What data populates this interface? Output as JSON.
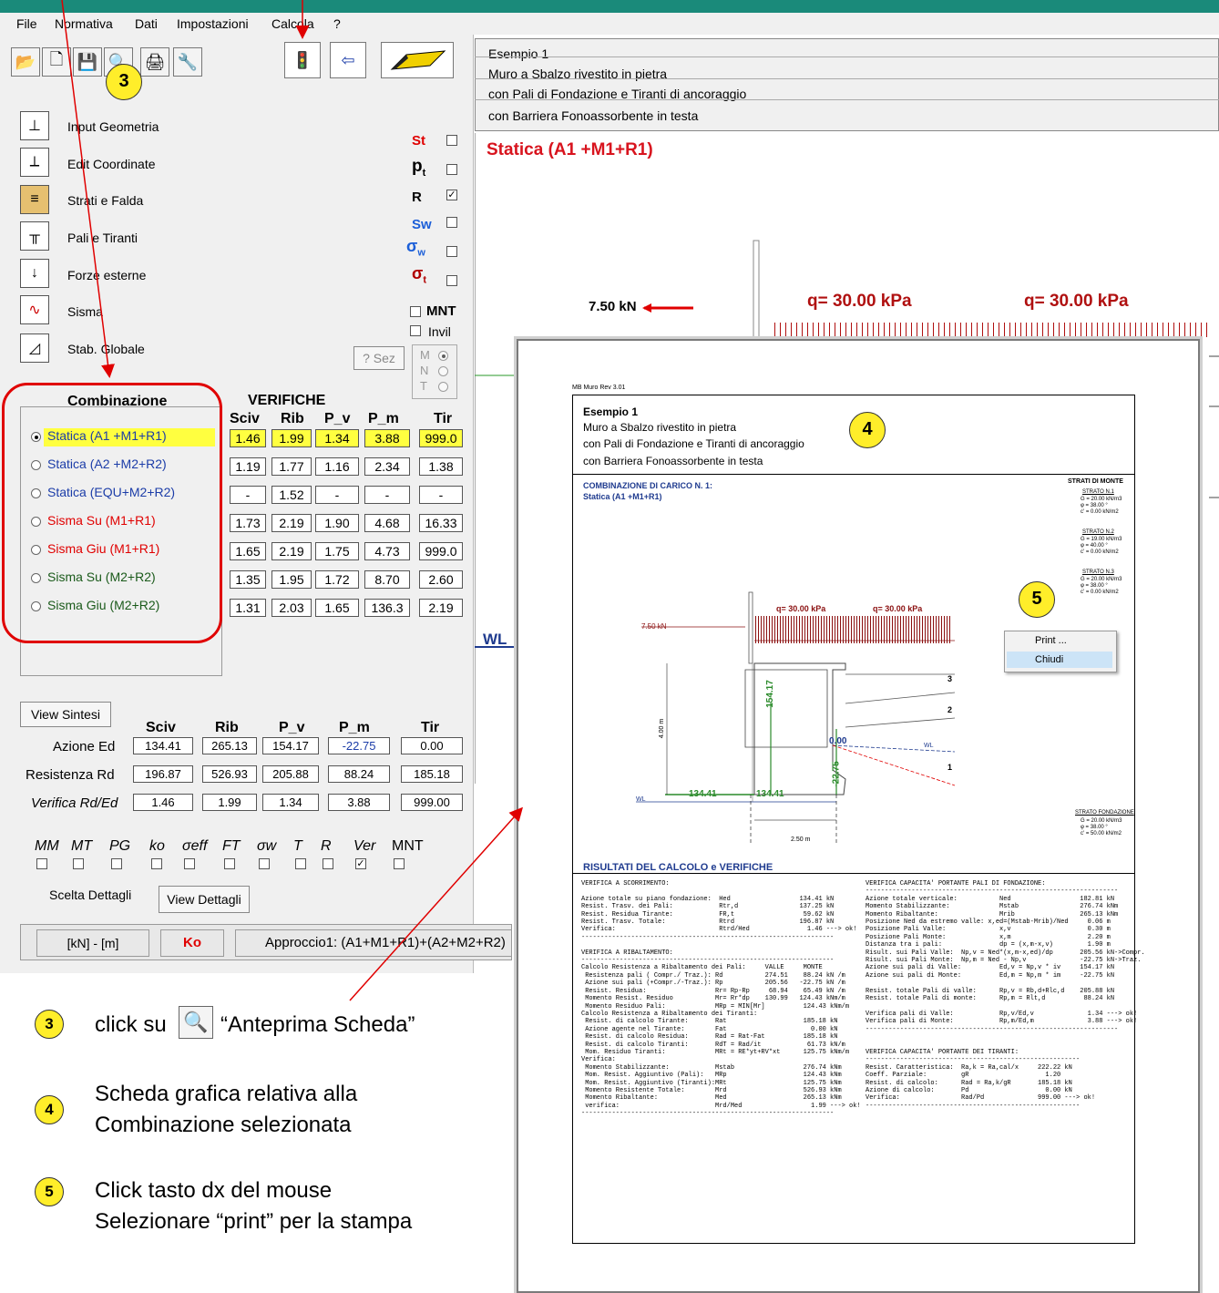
{
  "menu": [
    "File",
    "Normativa",
    "Dati",
    "Impostazioni",
    "Calcola",
    "?"
  ],
  "commands": [
    "Input Geometria",
    "Edit Coordinate",
    "Strati e Falda",
    "Pali e Tiranti",
    "Forze esterne",
    "Sisma",
    "Stab. Globale"
  ],
  "flags": {
    "st": "St",
    "pt": "p",
    "pt_sub": "t",
    "r": "R",
    "sw": "Sw",
    "sigw": "σ",
    "sigw_sub": "w",
    "sigt": "σ",
    "sigt_sub": "t",
    "mnt": "MNT",
    "invil": "Invil"
  },
  "sez_button": "? Sez",
  "mnt_radio": [
    "M",
    "N",
    "T"
  ],
  "combinazione": {
    "title": "Combinazione",
    "items": [
      "Statica  (A1 +M1+R1)",
      "Statica  (A2 +M2+R2)",
      "Statica  (EQU+M2+R2)",
      "Sisma Su  (M1+R1)",
      "Sisma Giu (M1+R1)",
      "Sisma Su  (M2+R2)",
      "Sisma Giu (M2+R2)"
    ]
  },
  "verifiche": {
    "title": "VERIFICHE",
    "headers": [
      "Sciv",
      "Rib",
      "P_v",
      "P_m",
      "Tir"
    ],
    "rows": [
      [
        "1.46",
        "1.99",
        "1.34",
        "3.88",
        "999.0"
      ],
      [
        "1.19",
        "1.77",
        "1.16",
        "2.34",
        "1.38"
      ],
      [
        "-",
        "1.52",
        "-",
        "-",
        "-"
      ],
      [
        "1.73",
        "2.19",
        "1.90",
        "4.68",
        "16.33"
      ],
      [
        "1.65",
        "2.19",
        "1.75",
        "4.73",
        "999.0"
      ],
      [
        "1.35",
        "1.95",
        "1.72",
        "8.70",
        "2.60"
      ],
      [
        "1.31",
        "2.03",
        "1.65",
        "136.3",
        "2.19"
      ]
    ]
  },
  "sintesi": {
    "button": "View Sintesi",
    "headers": [
      "Sciv",
      "Rib",
      "P_v",
      "P_m",
      "Tir"
    ],
    "row_labels": [
      "Azione Ed",
      "Resistenza Rd",
      "Verifica Rd/Ed"
    ],
    "rows": [
      [
        "134.41",
        "265.13",
        "154.17",
        "-22.75",
        "0.00"
      ],
      [
        "196.87",
        "526.93",
        "205.88",
        "88.24",
        "185.18"
      ],
      [
        "1.46",
        "1.99",
        "1.34",
        "3.88",
        "999.00"
      ]
    ]
  },
  "detail_flags": [
    "MM",
    "MT",
    "PG",
    "ko",
    "σeff",
    "FT",
    "σw",
    "T",
    "R",
    "Ver",
    "MNT"
  ],
  "scelta_label": "Scelta Dettagli",
  "view_dettagli": "View Dettagli",
  "status": {
    "units": "[kN] - [m]",
    "result": "Ko",
    "approach": "Approccio1: (A1+M1+R1)+(A2+M2+R2)"
  },
  "description": [
    "Esempio 1",
    "Muro a Sbalzo rivestito in pietra",
    "con Pali di Fondazione e Tiranti di ancoraggio",
    "con Barriera Fonoassorbente in testa"
  ],
  "plot": {
    "title": "Statica  (A1 +M1+R1)",
    "force": "7.50 kN",
    "q1": "q= 30.00 kPa",
    "q2": "q= 30.00 kPa",
    "wl": "WL"
  },
  "sheet": {
    "header": "MB Muro Rev 3.01",
    "desc": [
      "Esempio 1",
      "Muro a Sbalzo rivestito in pietra",
      "con Pali di Fondazione e Tiranti di ancoraggio",
      "con Barriera Fonoassorbente in testa"
    ],
    "comb_title": "COMBINAZIONE DI CARICO N. 1:",
    "comb_name": "Statica  (A1 +M1+R1)",
    "strati_title": "STRATI DI MONTE",
    "strati": [
      {
        "name": "STRATO N.1",
        "g": "G = 20.00 kN/m3",
        "phi": "φ = 38.00 °",
        "c": "c' = 0.00 kN/m2"
      },
      {
        "name": "STRATO N.2",
        "g": "G = 19.00 kN/m3",
        "phi": "φ = 40.00 °",
        "c": "c' = 0.00 kN/m2"
      },
      {
        "name": "STRATO N.3",
        "g": "G = 20.00 kN/m3",
        "phi": "φ = 38.00 °",
        "c": "c' = 0.00 kN/m2"
      }
    ],
    "fondazione": {
      "name": "STRATO FONDAZIONE",
      "g": "G = 20.00 kN/m3",
      "phi": "φ = 38.00 °",
      "c": "c' = 50.00 kN/m2"
    },
    "q1": "q= 30.00 kPa",
    "q2": "q= 30.00 kPa",
    "force": "7.50 kN",
    "dims": {
      "h": "4.00 m",
      "b": "2.50 m"
    },
    "values": {
      "v1": "134.41",
      "v2": "134.41",
      "v3": "154.17",
      "v4": "0.00",
      "v5": "-22.75"
    },
    "wl": "WL",
    "layers": [
      "3",
      "2",
      "1"
    ],
    "results_title": "RISULTATI DEL CALCOLO e VERIFICHE",
    "left_text": "VERIFICA A SCORRIMENTO:\n\nAzione totale su piano fondazione:  Hed                  134.41 kN\nResist. Trasv. dei Pali:            Rtr,d                137.25 kN\nResist. Residua Tirante:            FR,t                  59.62 kN\nResist. Trasv. Totale:              Rtrd                 196.87 kN\nVerifica:                           Rtrd/Hed               1.46 ---> ok!\n------------------------------------------------------------------\n\nVERIFICA A RIBALTAMENTO:\n------------------------------------------------------------------\nCalcolo Resistenza a Ribaltamento dei Pali:     VALLE     MONTE\n Resistenza pali ( Compr./ Traz.): Rd           274.51    88.24 kN /m\n Azione sui pali (+Compr./-Traz.): Rp           205.56   -22.75 kN /m\n Resist. Residua:                  Rr= Rp-Rp     68.94    65.49 kN /m\n Momento Resist. Residuo           Mr= Rr*dp    130.99   124.43 kNm/m\n Momento Residuo Pali:             MRp = MIN[Mr]          124.43 kNm/m\nCalcolo Resistenza a Ribaltamento dei Tiranti:\n Resist. di calcolo Tirante:       Rat                    185.18 kN\n Azione agente nel Tirante:        Fat                      0.00 kN\n Resist. di calcolo Residua:       Rad = Rat-Fat          185.18 kN\n Resist. di calcolo Tiranti:       RdT = Rad/it            61.73 kN/m\n Mom. Residuo Tiranti:             MRt = RE*yt+RV*xt      125.75 kNm/m\nVerifica:\n Momento Stabilizzante:            Mstab                  276.74 kNm\n Mom. Resist. Aggiuntivo (Pali):   MRp                    124.43 kNm\n Mom. Resist. Aggiuntivo (Tiranti):MRt                    125.75 kNm\n Momento Resistente Totale:        Mrd                    526.93 kNm\n Momento Ribaltante:               Med                    265.13 kNm\n verifica:                         Mrd/Med                  1.99 ---> ok!\n------------------------------------------------------------------",
    "right_text": "VERIFICA CAPACITA' PORTANTE PALI DI FONDAZIONE:\n------------------------------------------------------------------\nAzione totale verticale:           Ned                  182.81 kN\nMomento Stabilizzante:             Mstab                276.74 kNm\nMomento Ribaltante:                Mrib                 265.13 kNm\nPosizione Ned da estremo valle: x,ed=(Mstab-Mrib)/Ned     0.06 m\nPosizione Pali Valle:              x,v                    0.30 m\nPosizione Pali Monte:              x,m                    2.20 m\nDistanza tra i pali:               dp = (x,m-x,v)         1.90 m\nRisult. sui Pali Valle:  Np,v = Ned*(x,m-x,ed)/dp       205.56 kN->Compr.\nRisult. sui Pali Monte:  Np,m = Ned - Np,v              -22.75 kN->Traz.\nAzione sui pali di Valle:          Ed,v = Np,v * iv     154.17 kN\nAzione sui pali di Monte:          Ed,m = Np,m * im     -22.75 kN\n\nResist. totale Pali di valle:      Rp,v = Rb,d+Rlc,d    205.88 kN\nResist. totale Pali di monte:      Rp,m = Rlt,d          88.24 kN\n\nVerifica pali di Valle:            Rp,v/Ed,v              1.34 ---> ok!\nVerifica pali di Monte:            Rp,m/Ed,m              3.88 ---> ok!\n------------------------------------------------------------------\n\n\nVERIFICA CAPACITA' PORTANTE DEI TIRANTI:\n--------------------------------------------------------\nResist. Caratteristica:  Ra,k = Ra,cal/x     222.22 kN\nCoeff. Parziale:         gR                    1.20\nResist. di calcolo:      Rad = Ra,k/gR       185.18 kN\nAzione di calcolo:       Pd                    0.00 kN\nVerifica:                Rad/Pd              999.00 ---> ok!\n--------------------------------------------------------"
  },
  "context_menu": [
    "Print ...",
    "Chiudi"
  ],
  "callouts": [
    "3",
    "4",
    "5"
  ],
  "notes": {
    "n3_pre": "click su",
    "n3_post": "“Anteprima Scheda”",
    "n4": [
      "Scheda grafica relativa alla",
      "Combinazione selezionata"
    ],
    "n5": [
      "Click tasto dx del mouse",
      "Selezionare “print” per la stampa"
    ]
  },
  "colors": {
    "accent_red": "#e00000",
    "highlight_yellow": "#ffff40",
    "title_red": "#d8141e",
    "menu_highlight": "#cce4f7",
    "sheet_blue": "#1f3b8f"
  }
}
